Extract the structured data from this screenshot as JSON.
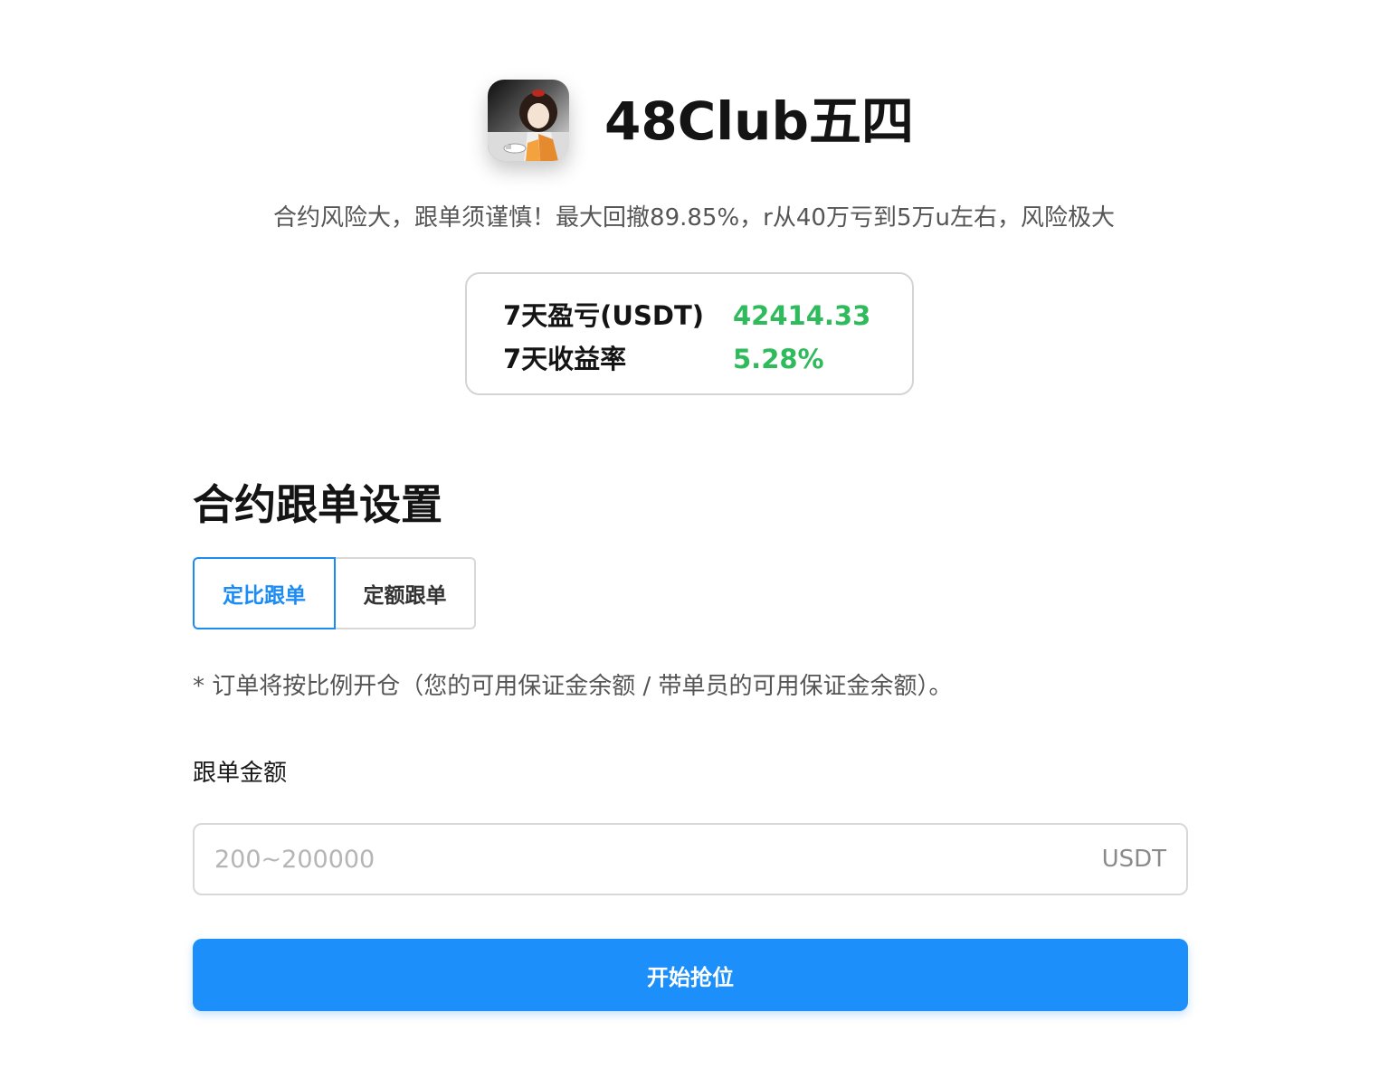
{
  "header": {
    "title": "48Club五四",
    "avatar_icon": "trader-avatar-illustration"
  },
  "description": "合约风险大，跟单须谨慎！最大回撤89.85%，r从40万亏到5万u左右，风险极大",
  "stats": {
    "pnl_label": "7天盈亏(USDT)",
    "pnl_value": "42414.33",
    "roi_label": "7天收益率",
    "roi_value": "5.28%",
    "positive_color": "#2fba5c"
  },
  "settings": {
    "title": "合约跟单设置",
    "tabs": [
      {
        "label": "定比跟单",
        "active": true
      },
      {
        "label": "定额跟单",
        "active": false
      }
    ],
    "note": "* 订单将按比例开仓（您的可用保证金余额 / 带单员的可用保证金余额）。",
    "amount": {
      "label": "跟单金额",
      "placeholder": "200~200000",
      "value": "",
      "unit": "USDT"
    },
    "submit_label": "开始抢位",
    "accent_color": "#1c8ffa"
  }
}
